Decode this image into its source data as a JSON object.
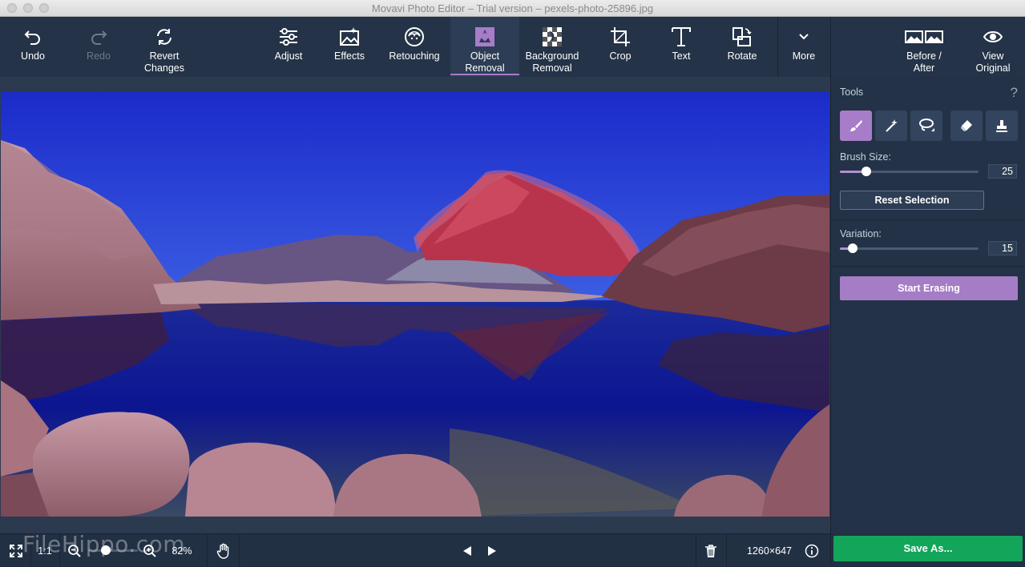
{
  "window": {
    "title": "Movavi Photo Editor – Trial version – pexels-photo-25896.jpg"
  },
  "toolbar": {
    "undo": "Undo",
    "redo": "Redo",
    "revert": "Revert\nChanges",
    "adjust": "Adjust",
    "effects": "Effects",
    "retouching": "Retouching",
    "object_removal": "Object\nRemoval",
    "background_removal": "Background\nRemoval",
    "crop": "Crop",
    "text": "Text",
    "rotate": "Rotate",
    "more": "More",
    "before_after": "Before /\nAfter",
    "view_original": "View\nOriginal"
  },
  "panel": {
    "tools_label": "Tools",
    "help": "?",
    "brush_size_label": "Brush Size:",
    "brush_size_value": "25",
    "brush_size_fraction": 0.19,
    "reset_selection": "Reset Selection",
    "variation_label": "Variation:",
    "variation_value": "15",
    "variation_fraction": 0.09,
    "start_erasing": "Start Erasing",
    "tools": [
      "brush-icon",
      "magic-wand-icon",
      "lasso-icon",
      "eraser-icon",
      "stamp-icon"
    ]
  },
  "bottombar": {
    "ratio": "1:1",
    "zoom": "82%",
    "zoom_fraction": 0.35,
    "dimensions": "1260×647",
    "save_as": "Save As..."
  },
  "watermark": "FileHippo.com",
  "colors": {
    "accent": "#a77cc9",
    "save": "#13a55a",
    "toolbar": "#243347"
  }
}
